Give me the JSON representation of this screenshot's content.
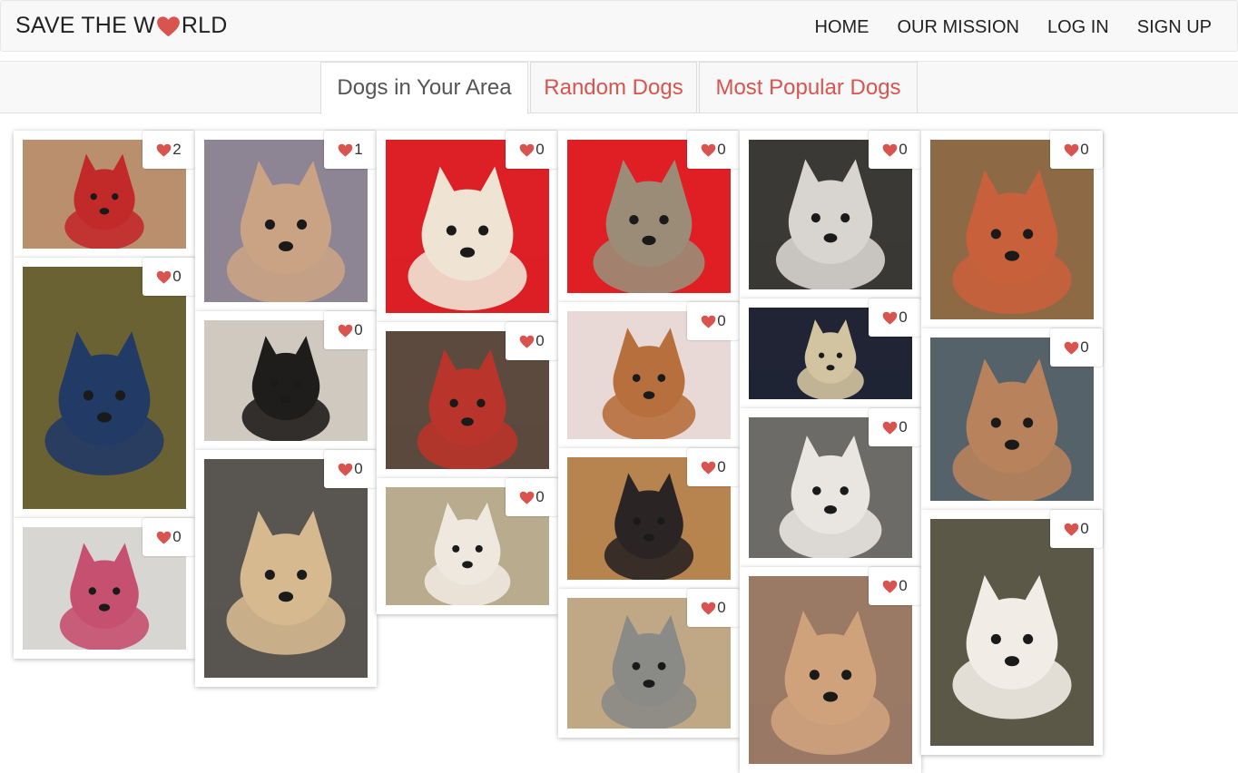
{
  "brand": {
    "before": "SAVE THE W",
    "after": "RLD",
    "heart_color": "#d9534f"
  },
  "nav": {
    "home": "HOME",
    "mission": "OUR MISSION",
    "login": "LOG IN",
    "signup": "SIGN UP"
  },
  "tabs": {
    "area": "Dogs in Your Area",
    "random": "Random Dogs",
    "popular": "Most Popular Dogs"
  },
  "colors": {
    "accent": "#d9534f",
    "active_tab_text": "#555555"
  },
  "icons": {
    "like": "heart-icon"
  },
  "dogs": {
    "c1r1": {
      "likes": "2",
      "bg": "#b98f6e",
      "fg": "#c22a2a"
    },
    "c1r2": {
      "likes": "0",
      "bg": "#6a6233",
      "fg": "#223a66"
    },
    "c1r3": {
      "likes": "0",
      "bg": "#d8d6d2",
      "fg": "#c65070"
    },
    "c2r1": {
      "likes": "1",
      "bg": "#8d8494",
      "fg": "#c9a384"
    },
    "c2r2": {
      "likes": "0",
      "bg": "#cfc9bf",
      "fg": "#1f1d1c"
    },
    "c2r3": {
      "likes": "0",
      "bg": "#595551",
      "fg": "#d6b98f"
    },
    "c3r1": {
      "likes": "0",
      "bg": "#dc2025",
      "fg": "#efe4d4"
    },
    "c3r2": {
      "likes": "0",
      "bg": "#5c4a3e",
      "fg": "#b9342a"
    },
    "c3r3": {
      "likes": "0",
      "bg": "#b8ab8e",
      "fg": "#efe8de"
    },
    "c4r1": {
      "likes": "0",
      "bg": "#e01f25",
      "fg": "#9b8c78"
    },
    "c4r2": {
      "likes": "0",
      "bg": "#e8d8d6",
      "fg": "#b7703d"
    },
    "c4r3": {
      "likes": "0",
      "bg": "#b7844f",
      "fg": "#2a2524"
    },
    "c4r4": {
      "likes": "0",
      "bg": "#c0a886",
      "fg": "#8a8a86"
    },
    "c5r1": {
      "likes": "0",
      "bg": "#3b3936",
      "fg": "#d8d4cf"
    },
    "c5r2": {
      "likes": "0",
      "bg": "#202435",
      "fg": "#d2c4a0"
    },
    "c5r3": {
      "likes": "0",
      "bg": "#6c6b67",
      "fg": "#e9e6e1"
    },
    "c5r4": {
      "likes": "0",
      "bg": "#9a7965",
      "fg": "#cfa27c"
    },
    "c6r1": {
      "likes": "0",
      "bg": "#8d6a45",
      "fg": "#c8603b"
    },
    "c6r2": {
      "likes": "0",
      "bg": "#55626a",
      "fg": "#b8835c"
    },
    "c6r3": {
      "likes": "0",
      "bg": "#5b5847",
      "fg": "#f1ede6"
    }
  }
}
